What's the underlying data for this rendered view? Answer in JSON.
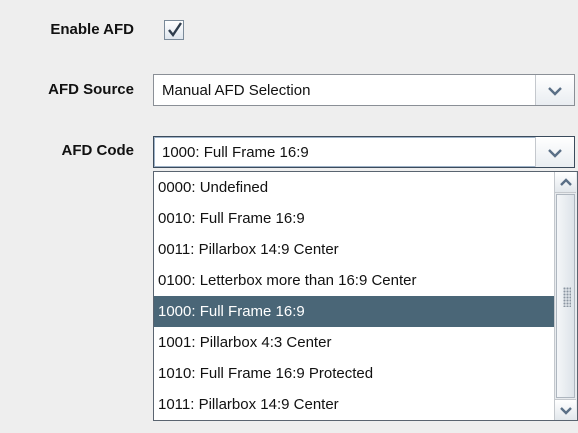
{
  "enable_afd": {
    "label": "Enable AFD",
    "checked": true
  },
  "afd_source": {
    "label": "AFD Source",
    "value": "Manual AFD Selection"
  },
  "afd_code": {
    "label": "AFD Code",
    "value": "1000: Full Frame 16:9",
    "options": [
      "0000: Undefined",
      "0010: Full Frame 16:9",
      "0011: Pillarbox 14:9 Center",
      "0100: Letterbox more than 16:9 Center",
      "1000: Full Frame 16:9",
      "1001: Pillarbox 4:3 Center",
      "1010: Full Frame 16:9 Protected",
      "1011: Pillarbox 14:9 Center"
    ],
    "selected_index": 4
  },
  "icons": {
    "checkbox": "checkmark-icon",
    "combo_arrow": "chevron-down-icon",
    "scroll_up": "chevron-up-icon",
    "scroll_down": "chevron-down-icon"
  },
  "colors": {
    "selection": "#4a6677",
    "background": "#eeeeee"
  }
}
